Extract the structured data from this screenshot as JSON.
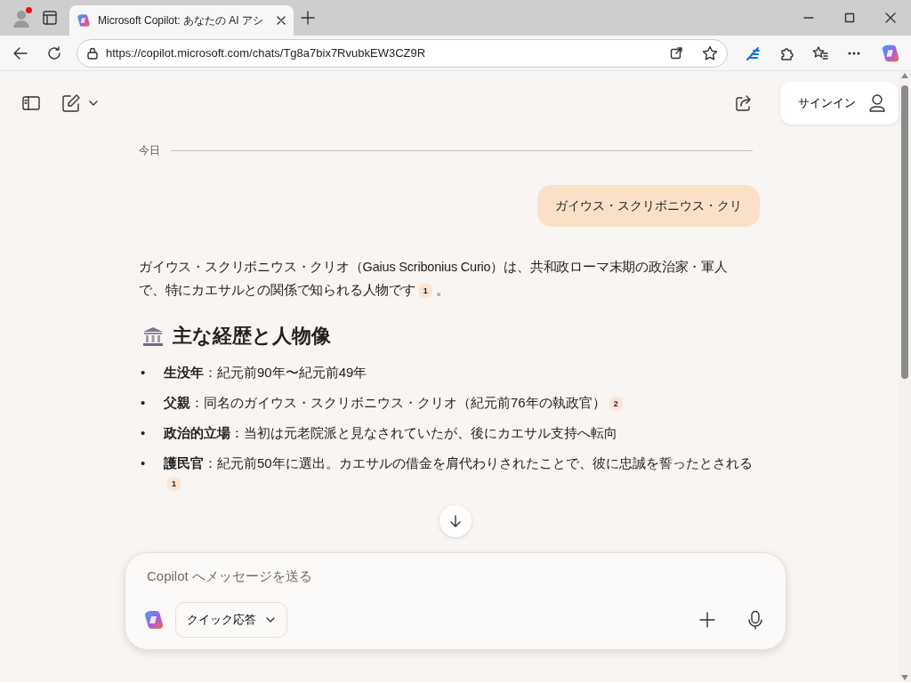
{
  "browser": {
    "tab_title": "Microsoft Copilot: あなたの AI アシ",
    "url": "https://copilot.microsoft.com/chats/Tg8a7bix7RvubkEW3CZ9R",
    "profile_notification": true
  },
  "header": {
    "signin": "サインイン"
  },
  "chat": {
    "date_divider": "今日",
    "user_message": "ガイウス・スクリボニウス・クリ",
    "intro": "ガイウス・スクリボニウス・クリオ（Gaius Scribonius Curio）は、共和政ローマ末期の政治家・軍人で、特にカエサルとの関係で知られる人物です",
    "intro_cite": "1",
    "intro_end": "。",
    "heading": "主な経歴と人物像",
    "bullets": [
      {
        "marker": "•",
        "text": "**生没年**：紀元前90年〜紀元前49年"
      },
      {
        "marker": "•",
        "text": "**父親**：同名のガイウス・スクリボニウス・クリオ（紀元前76年の執政官）",
        "cite": "2"
      },
      {
        "marker": "•",
        "text": "**政治的立場**：当初は元老院派と見なされていたが、後にカエサル支持へ転向"
      },
      {
        "marker": "•",
        "text": "**護民官**：紀元前50年に選出。カエサルの借金を肩代わりされたことで、彼に忠誠を誓ったとされる",
        "cite": "1"
      }
    ]
  },
  "composer": {
    "placeholder": "Copilot へメッセージを送る",
    "mode": "クイック応答"
  }
}
